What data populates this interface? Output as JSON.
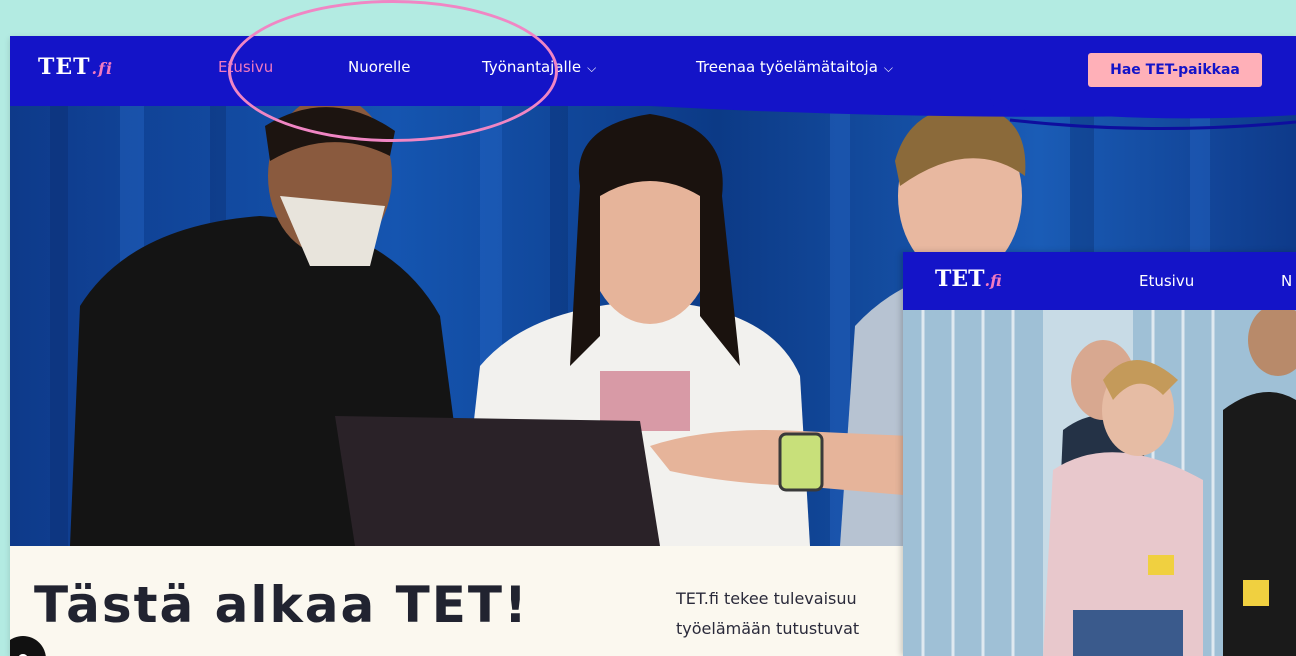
{
  "main_site": {
    "logo": {
      "text": "TET",
      "suffix": ".fi"
    },
    "nav": {
      "items": [
        {
          "label": "Etusivu",
          "active": true,
          "dropdown": false
        },
        {
          "label": "Nuorelle",
          "active": false,
          "dropdown": false
        },
        {
          "label": "Työnantajalle",
          "active": false,
          "dropdown": true
        },
        {
          "label": "Treenaa työelämätaitoja",
          "active": false,
          "dropdown": true
        }
      ],
      "cta_label": "Hae TET-paikkaa"
    },
    "hero_title": "Tästä alkaa TET!",
    "intro_line1": "TET.fi tekee tulevaisuu",
    "intro_line2": "työelämään tutustuvat"
  },
  "secondary_site": {
    "logo": {
      "text": "TET",
      "suffix": ".fi"
    },
    "nav": {
      "items": [
        {
          "label": "Etusivu"
        },
        {
          "label": "N"
        }
      ]
    }
  },
  "colors": {
    "background": "#b3ebe2",
    "nav_bg": "#1414c8",
    "active_nav": "#f07ac0",
    "cta_bg": "#ffb0b8",
    "highlight": "#f086c4"
  },
  "icons": {
    "dropdown": "chevron-down-icon",
    "chat": "chat-icon"
  }
}
